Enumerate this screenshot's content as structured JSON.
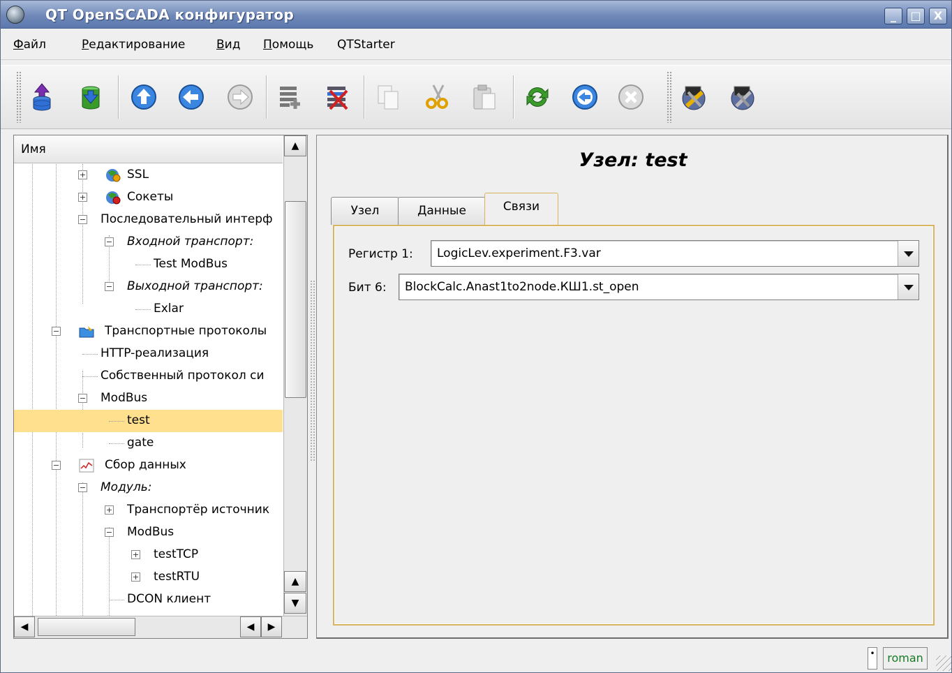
{
  "window": {
    "title": "QT OpenSCADA конфигуратор",
    "buttons": {
      "minimize": "_",
      "maximize": "□",
      "close": "X"
    }
  },
  "menu": [
    {
      "label": "Файл",
      "mnemonic": "Ф",
      "rest": "айл"
    },
    {
      "label": "Редактирование",
      "mnemonic": "Р",
      "rest": "едактирование"
    },
    {
      "label": "Вид",
      "mnemonic": "В",
      "rest": "ид"
    },
    {
      "label": "Помощь",
      "mnemonic": "П",
      "rest": "омощь"
    },
    {
      "label": "QTStarter",
      "mnemonic": "",
      "rest": "QTStarter"
    }
  ],
  "toolbar": {
    "icons": [
      "db-load-icon",
      "db-save-icon",
      "up-icon",
      "back-icon",
      "forward-icon",
      "add-item-icon",
      "delete-item-icon",
      "copy-icon",
      "cut-icon",
      "paste-icon",
      "refresh-icon",
      "start-icon",
      "stop-icon",
      "configurator-icon",
      "starter-icon"
    ],
    "colors": {
      "blue": "#2f6fd6",
      "green": "#3a9a2a",
      "red": "#d02020"
    }
  },
  "tree": {
    "header": "Имя",
    "rows": [
      {
        "label": "SSL",
        "italic": false
      },
      {
        "label": "Сокеты",
        "italic": false
      },
      {
        "label": "Последовательный интерф",
        "italic": false
      },
      {
        "label": "Входной транспорт:",
        "italic": true
      },
      {
        "label": "Test ModBus",
        "italic": false
      },
      {
        "label": "Выходной транспорт:",
        "italic": true
      },
      {
        "label": "Exlar",
        "italic": false
      },
      {
        "label": "Транспортные протоколы",
        "italic": false
      },
      {
        "label": "HTTP-реализация",
        "italic": false
      },
      {
        "label": "Собственный протокол си",
        "italic": false
      },
      {
        "label": "ModBus",
        "italic": false
      },
      {
        "label": "test",
        "italic": false,
        "selected": true
      },
      {
        "label": "gate",
        "italic": false
      },
      {
        "label": "Сбор данных",
        "italic": false
      },
      {
        "label": "Модуль:",
        "italic": true
      },
      {
        "label": "Транспортёр источник",
        "italic": false
      },
      {
        "label": "ModBus",
        "italic": false
      },
      {
        "label": "testTCP",
        "italic": false
      },
      {
        "label": "testRTU",
        "italic": false
      },
      {
        "label": "DCON клиент",
        "italic": false
      }
    ],
    "selection_color": "#ffe08f"
  },
  "node": {
    "title": "Узел: test",
    "tabs": [
      "Узел",
      "Данные",
      "Связи"
    ],
    "active_tab": "Связи",
    "fields": [
      {
        "label": "Регистр 1:",
        "value": "LogicLev.experiment.F3.var"
      },
      {
        "label": "Бит 6:",
        "value": "BlockCalc.Anast1to2node.КШ1.st_open"
      }
    ]
  },
  "status": {
    "indicator": "•",
    "user": "roman",
    "user_color": "#177a25"
  }
}
